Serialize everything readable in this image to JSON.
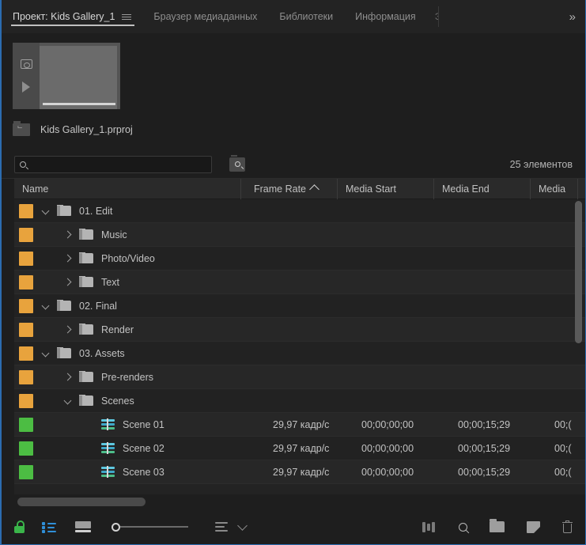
{
  "tabs": {
    "items": [
      {
        "label": "Проект: Kids Gallery_1",
        "active": true,
        "has_menu": true
      },
      {
        "label": "Браузер медиаданных",
        "active": false
      },
      {
        "label": "Библиотеки",
        "active": false
      },
      {
        "label": "Информация",
        "active": false
      }
    ],
    "clipped_tab": "Э",
    "overflow": "»"
  },
  "preview": {
    "camera_icon": "camera-icon",
    "play_icon": "play-icon",
    "project_file_name": "Kids Gallery_1.prproj",
    "project_file_icon": "project-bin-icon"
  },
  "search": {
    "value": "",
    "placeholder": "",
    "icon": "search-icon",
    "find_button_icon": "find-in-project-icon",
    "item_count": "25 элементов"
  },
  "table": {
    "columns": [
      {
        "label": "Name",
        "sorted": false
      },
      {
        "label": "Frame Rate",
        "sorted": true,
        "sort_dir": "asc"
      },
      {
        "label": "Media Start",
        "sorted": false
      },
      {
        "label": "Media End",
        "sorted": false
      },
      {
        "label": "Media",
        "sorted": false
      }
    ],
    "rows": [
      {
        "label": "01. Edit",
        "type": "bin",
        "chip": "#E8A33D",
        "indent": 0,
        "state": "open",
        "frame_rate": "",
        "media_start": "",
        "media_end": "",
        "media_dur": ""
      },
      {
        "label": "Music",
        "type": "bin",
        "chip": "#E8A33D",
        "indent": 1,
        "state": "closed",
        "frame_rate": "",
        "media_start": "",
        "media_end": "",
        "media_dur": ""
      },
      {
        "label": "Photo/Video",
        "type": "bin",
        "chip": "#E8A33D",
        "indent": 1,
        "state": "closed",
        "frame_rate": "",
        "media_start": "",
        "media_end": "",
        "media_dur": ""
      },
      {
        "label": "Text",
        "type": "bin",
        "chip": "#E8A33D",
        "indent": 1,
        "state": "closed",
        "frame_rate": "",
        "media_start": "",
        "media_end": "",
        "media_dur": ""
      },
      {
        "label": "02. Final",
        "type": "bin",
        "chip": "#E8A33D",
        "indent": 0,
        "state": "open",
        "frame_rate": "",
        "media_start": "",
        "media_end": "",
        "media_dur": ""
      },
      {
        "label": "Render",
        "type": "bin",
        "chip": "#E8A33D",
        "indent": 1,
        "state": "closed",
        "frame_rate": "",
        "media_start": "",
        "media_end": "",
        "media_dur": ""
      },
      {
        "label": "03. Assets",
        "type": "bin",
        "chip": "#E8A33D",
        "indent": 0,
        "state": "open",
        "frame_rate": "",
        "media_start": "",
        "media_end": "",
        "media_dur": ""
      },
      {
        "label": "Pre-renders",
        "type": "bin",
        "chip": "#E8A33D",
        "indent": 1,
        "state": "closed",
        "frame_rate": "",
        "media_start": "",
        "media_end": "",
        "media_dur": ""
      },
      {
        "label": "Scenes",
        "type": "bin",
        "chip": "#E8A33D",
        "indent": 1,
        "state": "open",
        "frame_rate": "",
        "media_start": "",
        "media_end": "",
        "media_dur": ""
      },
      {
        "label": "Scene 01",
        "type": "sequence",
        "chip": "#4CBD43",
        "indent": 2,
        "state": "none",
        "frame_rate": "29,97 кадр/с",
        "media_start": "00;00;00;00",
        "media_end": "00;00;15;29",
        "media_dur": "00;("
      },
      {
        "label": "Scene 02",
        "type": "sequence",
        "chip": "#4CBD43",
        "indent": 2,
        "state": "none",
        "frame_rate": "29,97 кадр/с",
        "media_start": "00;00;00;00",
        "media_end": "00;00;15;29",
        "media_dur": "00;("
      },
      {
        "label": "Scene 03",
        "type": "sequence",
        "chip": "#4CBD43",
        "indent": 2,
        "state": "none",
        "frame_rate": "29,97 кадр/с",
        "media_start": "00;00;00;00",
        "media_end": "00;00;15;29",
        "media_dur": "00;("
      }
    ]
  },
  "toolbar": {
    "lock_icon": "unlocked-padlock-icon",
    "lock_color": "#3AB54A",
    "list_view_icon": "list-view-icon",
    "list_view_color": "#2F8FD8",
    "icon_view_icon": "icon-view-icon",
    "zoom_slider_icon": "zoom-slider",
    "sort_icon": "sort-icon",
    "sort_chevron_icon": "chevron-down-icon",
    "freeform_icon": "freeform-view-icon",
    "find_icon": "search-icon",
    "new_bin_icon": "new-bin-icon",
    "new_item_icon": "new-item-icon",
    "trash_icon": "trash-icon"
  }
}
